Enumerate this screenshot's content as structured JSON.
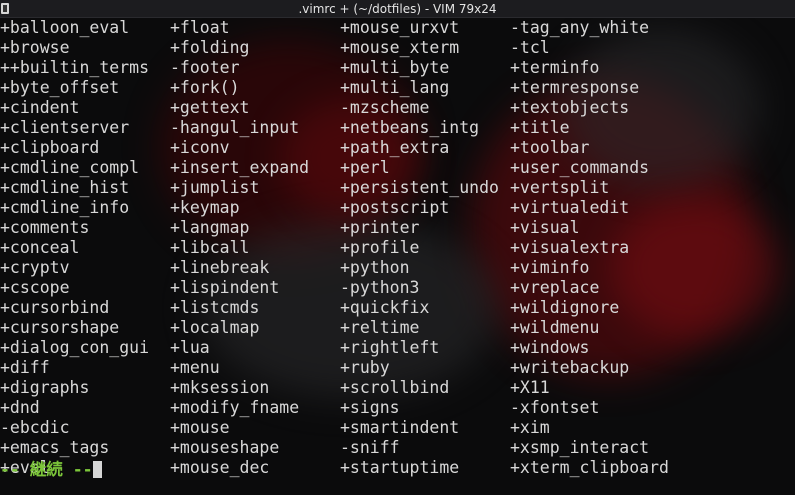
{
  "window": {
    "title": ".vimrc + (~/dotfiles) - VIM 79x24"
  },
  "colors": {
    "text": "#d8d8d8",
    "more_prompt": "#7cc63a",
    "background": "#0b0b0c",
    "wallpaper_red": "#6e0c10"
  },
  "features": {
    "columns": [
      [
        "+balloon_eval",
        "+browse",
        "++builtin_terms",
        "+byte_offset",
        "+cindent",
        "+clientserver",
        "+clipboard",
        "+cmdline_compl",
        "+cmdline_hist",
        "+cmdline_info",
        "+comments",
        "+conceal",
        "+cryptv",
        "+cscope",
        "+cursorbind",
        "+cursorshape",
        "+dialog_con_gui",
        "+diff",
        "+digraphs",
        "+dnd",
        "-ebcdic",
        "+emacs_tags",
        "+eval"
      ],
      [
        "+float",
        "+folding",
        "-footer",
        "+fork()",
        "+gettext",
        "-hangul_input",
        "+iconv",
        "+insert_expand",
        "+jumplist",
        "+keymap",
        "+langmap",
        "+libcall",
        "+linebreak",
        "+lispindent",
        "+listcmds",
        "+localmap",
        "+lua",
        "+menu",
        "+mksession",
        "+modify_fname",
        "+mouse",
        "+mouseshape",
        "+mouse_dec"
      ],
      [
        "+mouse_urxvt",
        "+mouse_xterm",
        "+multi_byte",
        "+multi_lang",
        "-mzscheme",
        "+netbeans_intg",
        "+path_extra",
        "+perl",
        "+persistent_undo",
        "+postscript",
        "+printer",
        "+profile",
        "+python",
        "-python3",
        "+quickfix",
        "+reltime",
        "+rightleft",
        "+ruby",
        "+scrollbind",
        "+signs",
        "+smartindent",
        "-sniff",
        "+startuptime"
      ],
      [
        "-tag_any_white",
        "-tcl",
        "+terminfo",
        "+termresponse",
        "+textobjects",
        "+title",
        "+toolbar",
        "+user_commands",
        "+vertsplit",
        "+virtualedit",
        "+visual",
        "+visualextra",
        "+viminfo",
        "+vreplace",
        "+wildignore",
        "+wildmenu",
        "+windows",
        "+writebackup",
        "+X11",
        "-xfontset",
        "+xim",
        "+xsmp_interact",
        "+xterm_clipboard"
      ]
    ]
  },
  "more_prompt": "-- 継続 --"
}
